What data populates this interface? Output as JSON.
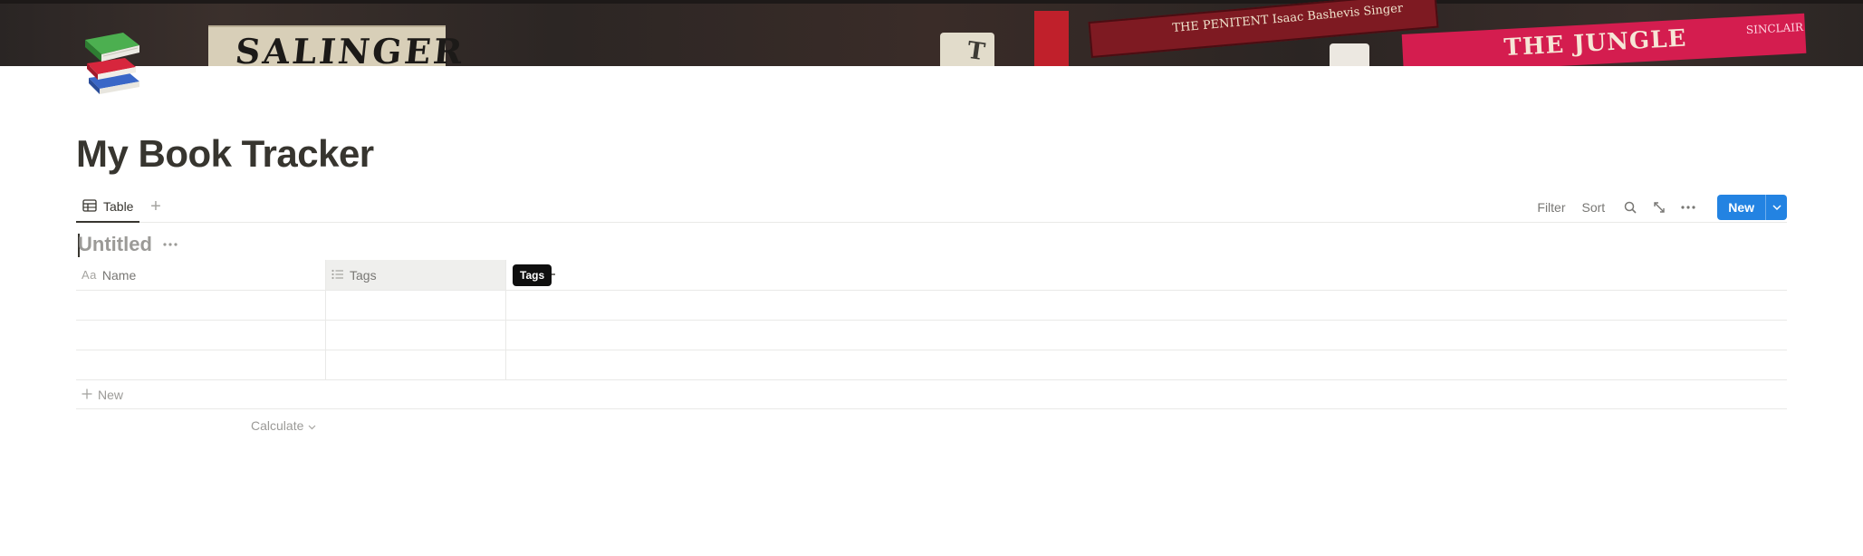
{
  "cover": {
    "book_salinger": "SALINGER",
    "book_t": "T",
    "book_penitent": "THE PENITENT  Isaac Bashevis Singer",
    "book_jungle": "THE JUNGLE",
    "book_jungle_author": "SINCLAIR"
  },
  "page": {
    "icon": "books-emoji-icon",
    "title": "My Book Tracker"
  },
  "views": {
    "tabs": [
      {
        "label": "Table",
        "icon": "table-icon"
      }
    ],
    "add_view_icon": "plus-icon"
  },
  "toolbar": {
    "filter_label": "Filter",
    "sort_label": "Sort",
    "search_icon": "search-icon",
    "expand_icon": "expand-arrows-icon",
    "more_icon": "more-horizontal-icon",
    "new_label": "New",
    "new_dropdown_icon": "chevron-down-icon"
  },
  "database": {
    "title_placeholder": "Untitled",
    "more_icon": "more-horizontal-icon",
    "columns": [
      {
        "label": "Name",
        "icon": "text-aa-icon",
        "icon_text": "Aa"
      },
      {
        "label": "Tags",
        "icon": "list-icon"
      }
    ],
    "tooltip": "Tags",
    "rows": [
      {
        "name": "",
        "tags": ""
      },
      {
        "name": "",
        "tags": ""
      },
      {
        "name": "",
        "tags": ""
      }
    ],
    "add_row_label": "New",
    "calculate_label": "Calculate"
  },
  "colors": {
    "accent": "#2383e2",
    "text": "#37352f",
    "muted": "#787774",
    "border": "#e9e9e7"
  }
}
